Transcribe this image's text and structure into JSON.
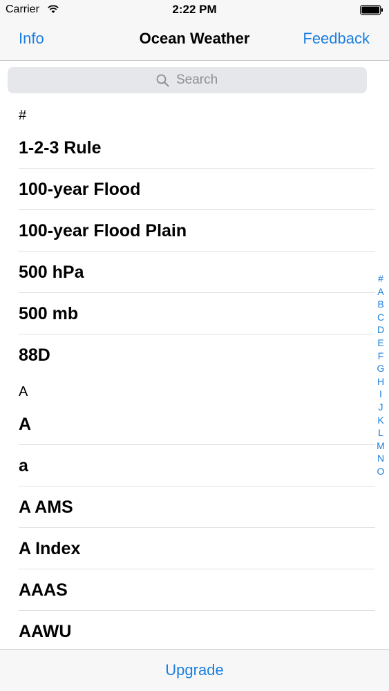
{
  "status_bar": {
    "carrier": "Carrier",
    "time": "2:22 PM"
  },
  "nav": {
    "left_label": "Info",
    "title": "Ocean Weather",
    "right_label": "Feedback"
  },
  "search": {
    "placeholder": "Search"
  },
  "sections": [
    {
      "header": "#",
      "items": [
        "1-2-3 Rule",
        "100-year Flood",
        "100-year Flood Plain",
        "500 hPa",
        "500 mb",
        "88D"
      ]
    },
    {
      "header": "A",
      "items": [
        "A",
        "a",
        "A AMS",
        "A Index",
        "AAAS",
        "AAWU"
      ]
    }
  ],
  "index_letters": [
    "#",
    "A",
    "B",
    "C",
    "D",
    "E",
    "F",
    "G",
    "H",
    "I",
    "J",
    "K",
    "L",
    "M",
    "N",
    "O"
  ],
  "toolbar": {
    "upgrade_label": "Upgrade"
  },
  "colors": {
    "accent": "#1a7fe0",
    "bar_background": "#f7f7f7",
    "search_background": "#e6e7ea"
  }
}
